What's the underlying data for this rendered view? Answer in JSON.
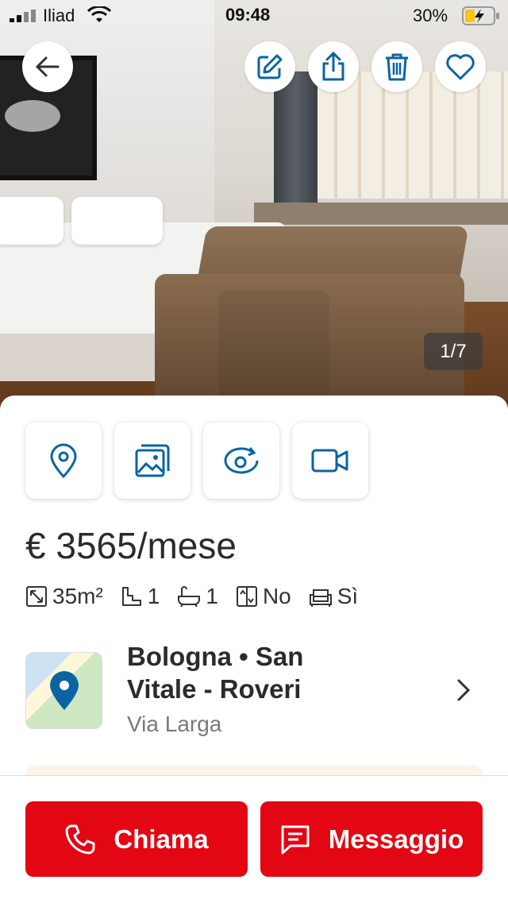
{
  "status_bar": {
    "carrier": "Iliad",
    "time": "09:48",
    "battery": "30%"
  },
  "gallery": {
    "counter": "1/7"
  },
  "listing": {
    "price": "€ 3565/mese",
    "features": [
      {
        "icon": "area-icon",
        "value": "35m²"
      },
      {
        "icon": "stairs-icon",
        "value": "1"
      },
      {
        "icon": "bathtub-icon",
        "value": "1"
      },
      {
        "icon": "elevator-icon",
        "value": "No"
      },
      {
        "icon": "furnished-icon",
        "value": "Sì"
      }
    ],
    "location": {
      "title": "Bologna • San Vitale - Roveri",
      "street": "Via Larga"
    }
  },
  "actions": {
    "call_label": "Chiama",
    "message_label": "Messaggio"
  },
  "colors": {
    "accent": "#0a64a4",
    "cta": "#e30613"
  }
}
